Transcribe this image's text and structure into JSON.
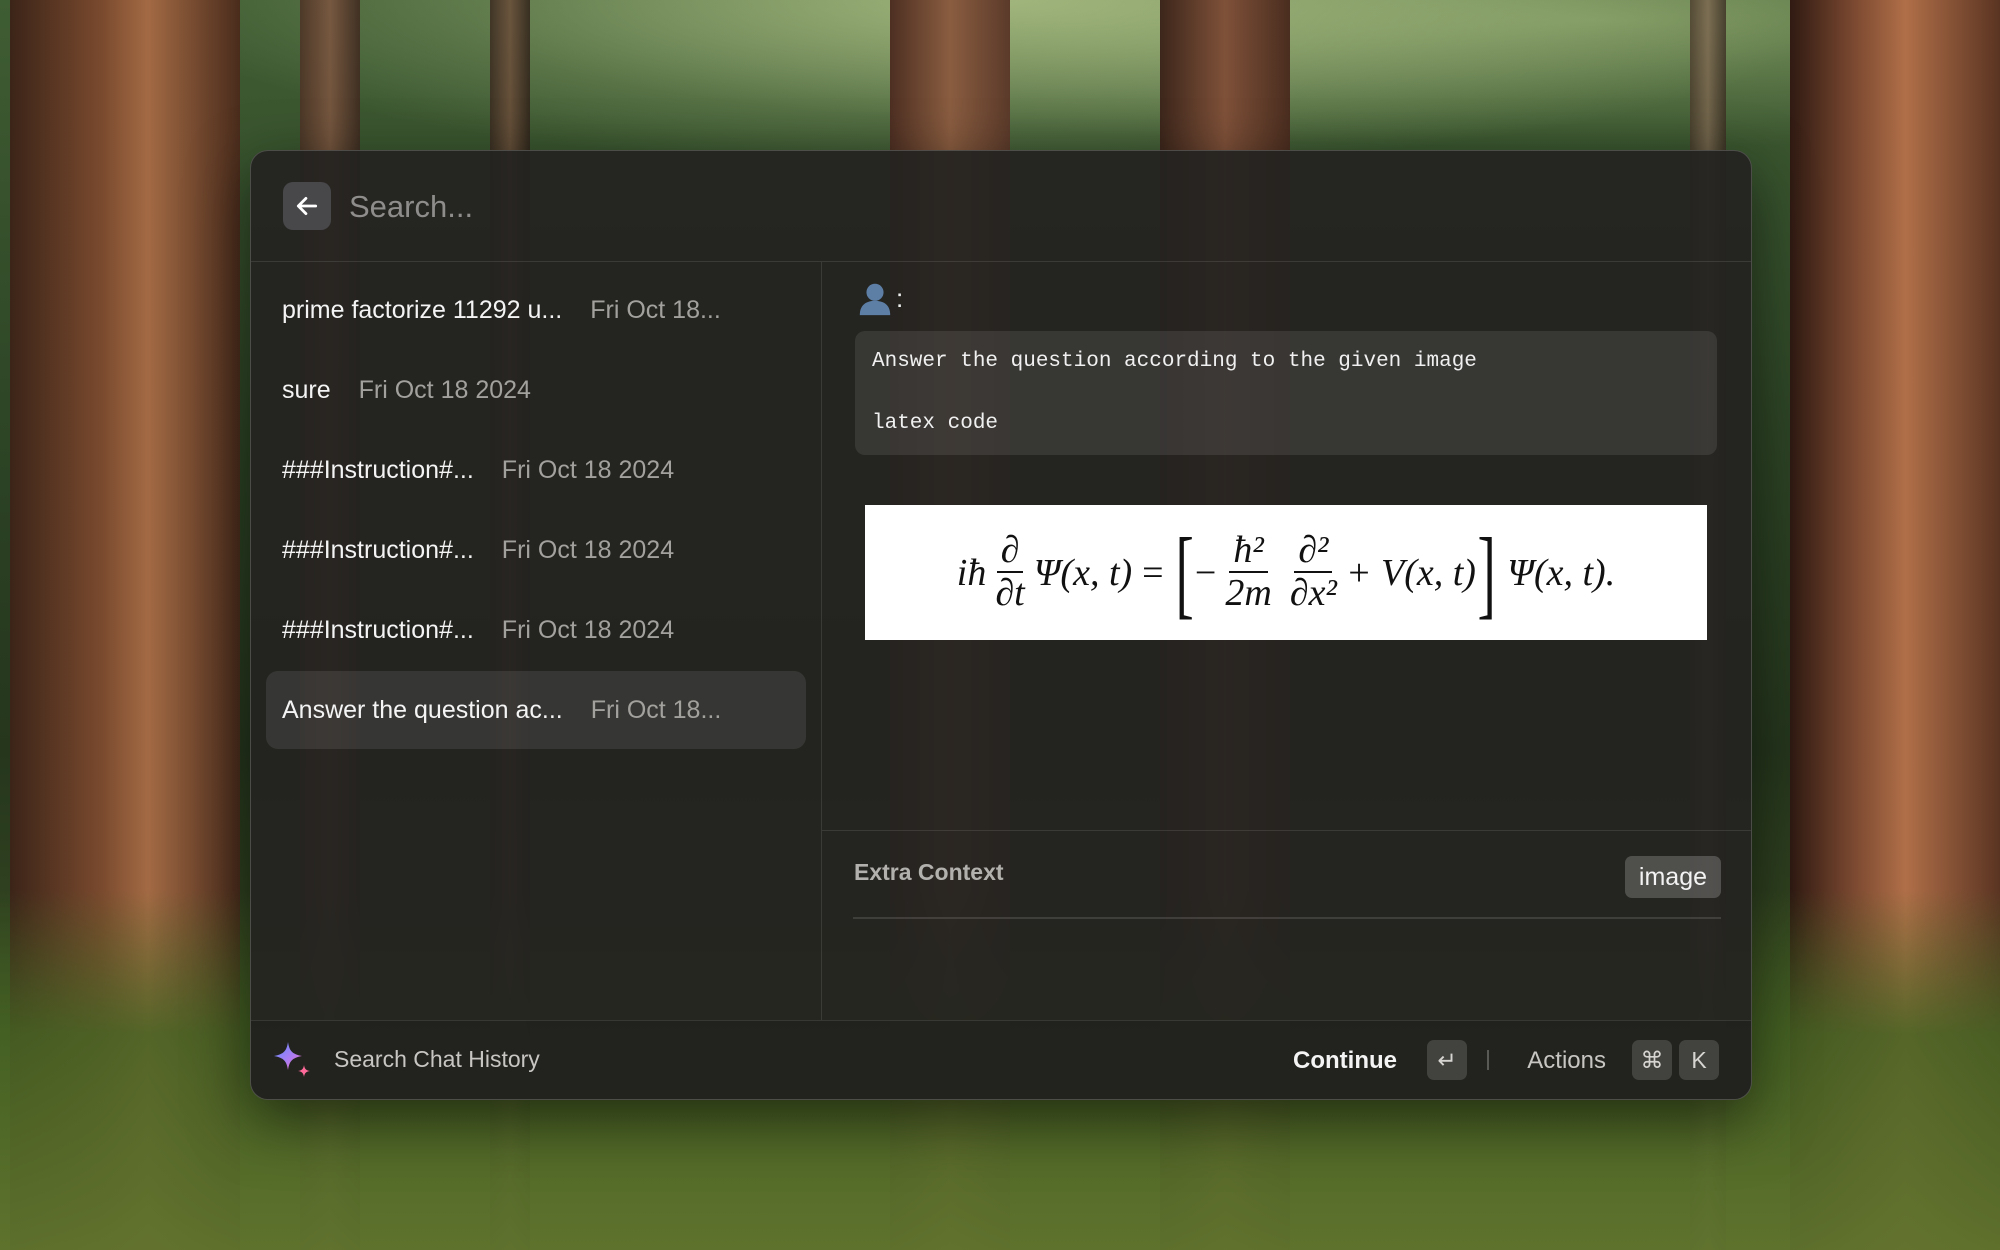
{
  "search": {
    "placeholder": "Search..."
  },
  "history": [
    {
      "title": "prime factorize 11292 u...",
      "date": "Fri Oct 18..."
    },
    {
      "title": "sure",
      "date": "Fri Oct 18 2024"
    },
    {
      "title": "###Instruction#...",
      "date": "Fri Oct 18 2024"
    },
    {
      "title": "###Instruction#...",
      "date": "Fri Oct 18 2024"
    },
    {
      "title": "###Instruction#...",
      "date": "Fri Oct 18 2024"
    },
    {
      "title": "Answer the question ac...",
      "date": "Fri Oct 18..."
    }
  ],
  "selected_index": 5,
  "detail": {
    "user_colon": ":",
    "message_line1": "Answer the question according to the given image",
    "message_line2": "latex code",
    "equation": {
      "lhs_coef": "iħ",
      "frac1_num": "∂",
      "frac1_den": "∂t",
      "psi": "Ψ(x, t)",
      "equals": "=",
      "minus": "−",
      "frac2_num": "ħ²",
      "frac2_den": "2m",
      "frac3_num": "∂²",
      "frac3_den": "∂x²",
      "plus_v": "+ V(x, t)",
      "rhs_psi": "Ψ(x, t)."
    },
    "extra_context_label": "Extra Context",
    "attachment_tag": "image"
  },
  "footer": {
    "title": "Search Chat History",
    "continue_label": "Continue",
    "continue_key": "↵",
    "actions_label": "Actions",
    "actions_key1": "⌘",
    "actions_key2": "K"
  },
  "icons": {
    "back": "arrow-left-icon",
    "user": "user-silhouette-icon",
    "ai": "sparkle-icon"
  },
  "colors": {
    "sparkle_blue": "#5b8cff",
    "sparkle_pink": "#ff6a9a"
  }
}
